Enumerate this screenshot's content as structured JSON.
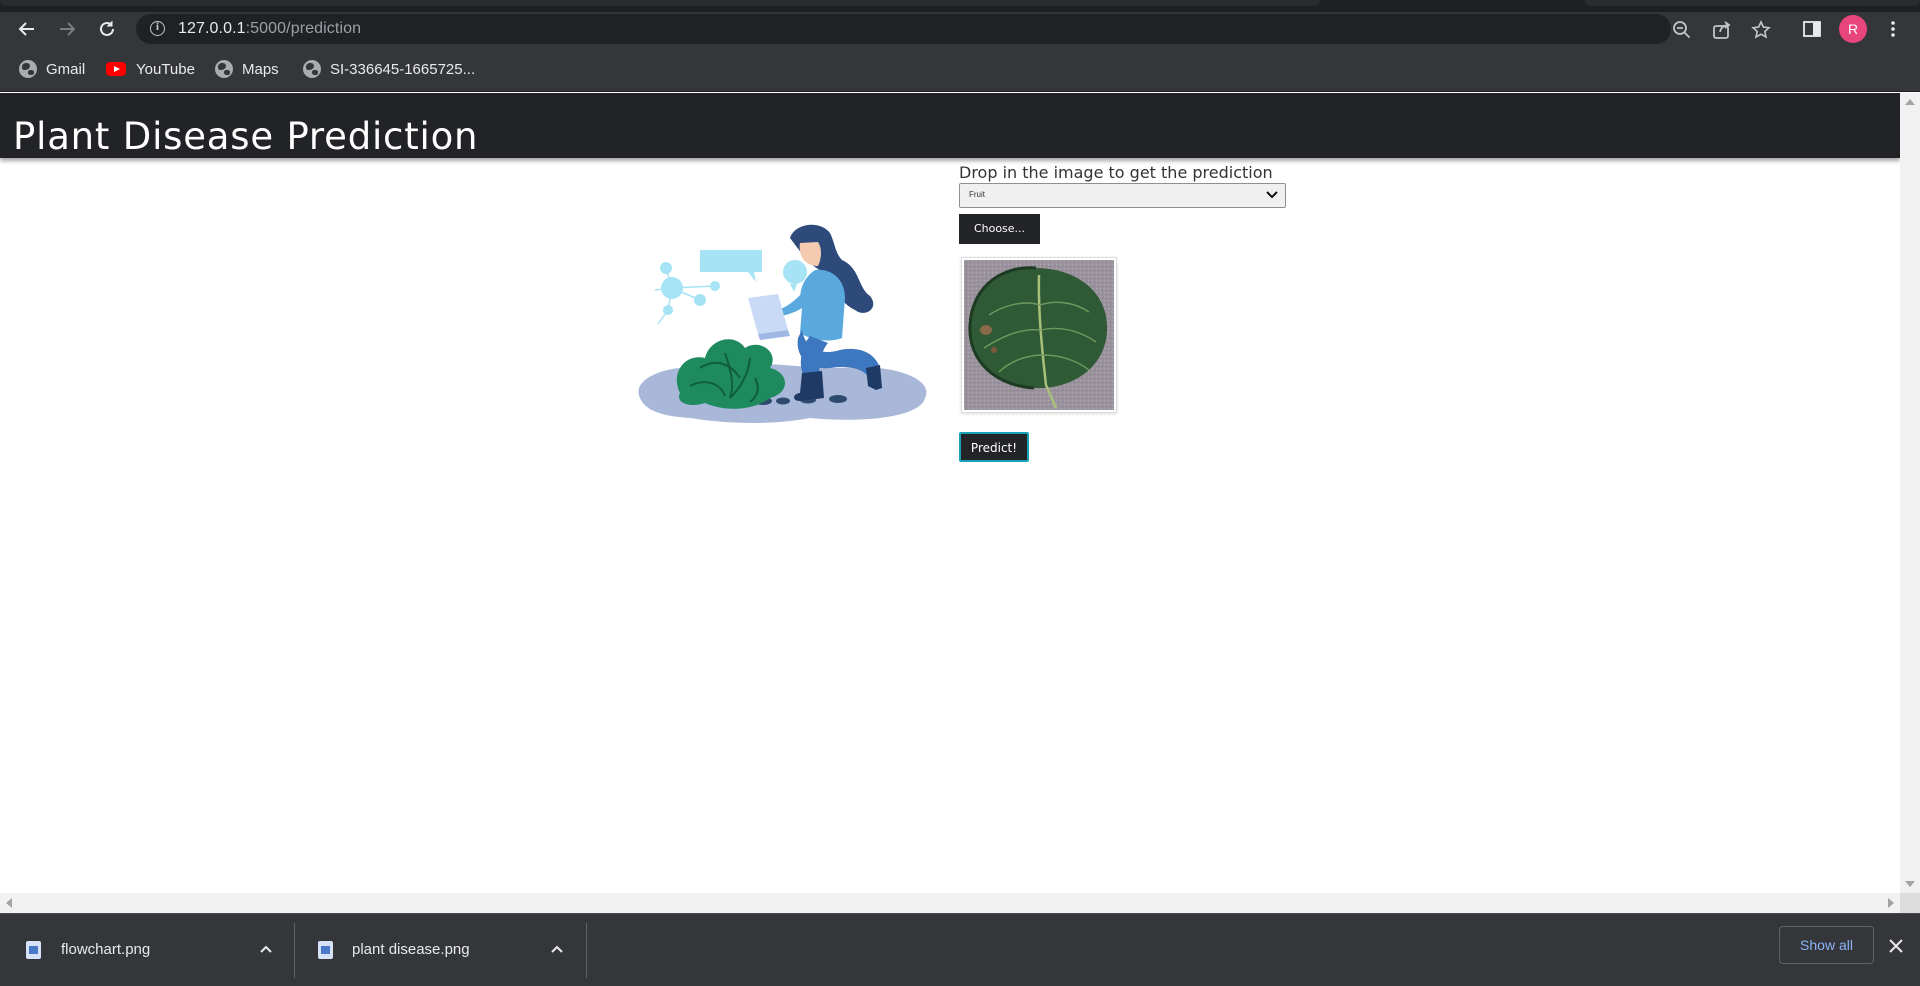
{
  "browser": {
    "url_host": "127.0.0.1",
    "url_path": ":5000/prediction",
    "avatar_letter": "R",
    "bookmarks": [
      {
        "label": "Gmail",
        "icon": "globe-icon"
      },
      {
        "label": "YouTube",
        "icon": "youtube-icon"
      },
      {
        "label": "Maps",
        "icon": "globe-icon"
      },
      {
        "label": "SI-336645-1665725...",
        "icon": "globe-icon"
      }
    ]
  },
  "page": {
    "title": "Plant Disease Prediction",
    "drop_label": "Drop in the image to get the prediction",
    "category_selected": "Fruit",
    "choose_label": "Choose...",
    "predict_label": "Predict!"
  },
  "downloads": {
    "items": [
      {
        "name": "flowchart.png"
      },
      {
        "name": "plant disease.png"
      }
    ],
    "show_all_label": "Show all"
  },
  "colors": {
    "header_bg": "#222326",
    "button_bg": "#232428",
    "predict_border": "#17a2b8",
    "chrome_bg": "#35363a",
    "avatar_bg": "#e8457d"
  }
}
